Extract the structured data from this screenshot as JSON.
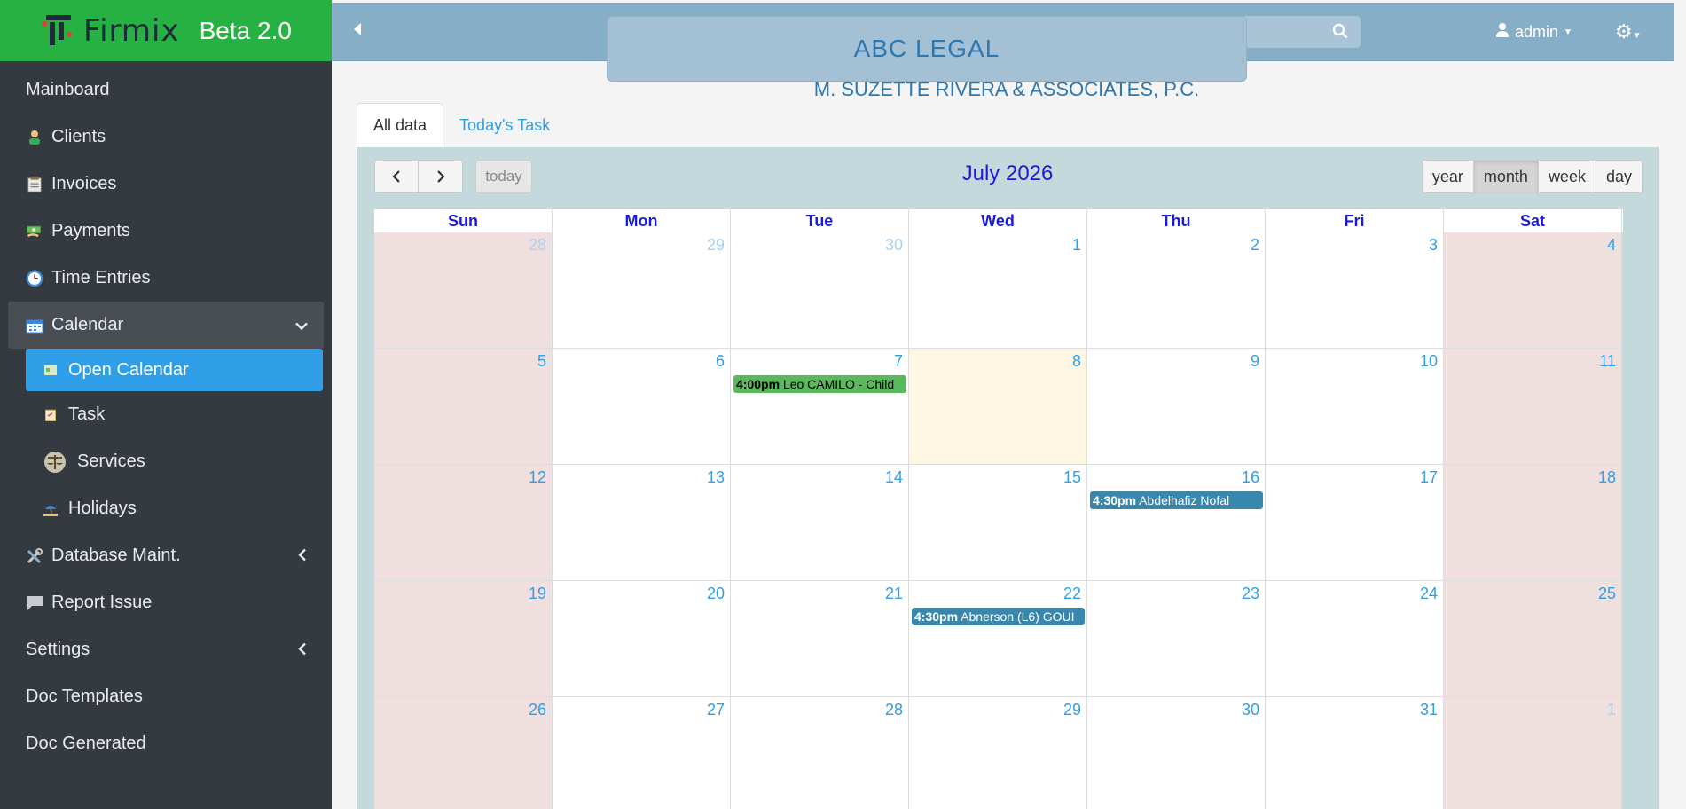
{
  "brand": {
    "name": "Firmix",
    "version": "Beta 2.0"
  },
  "sidebar": {
    "items": [
      {
        "label": "Mainboard",
        "icon": ""
      },
      {
        "label": "Clients",
        "icon": "person-icon"
      },
      {
        "label": "Invoices",
        "icon": "invoice-icon"
      },
      {
        "label": "Payments",
        "icon": "money-icon"
      },
      {
        "label": "Time Entries",
        "icon": "clock-icon"
      },
      {
        "label": "Calendar",
        "icon": "calendar-icon"
      },
      {
        "label": "Database Maint.",
        "icon": "tools-icon"
      },
      {
        "label": "Report Issue",
        "icon": "comment-icon"
      },
      {
        "label": "Settings",
        "icon": ""
      },
      {
        "label": "Doc Templates",
        "icon": ""
      },
      {
        "label": "Doc Generated",
        "icon": ""
      }
    ],
    "calendar_sub": [
      {
        "label": "Open Calendar",
        "icon": "card-icon"
      },
      {
        "label": "Task",
        "icon": "clipboard-icon"
      },
      {
        "label": "Services",
        "icon": "scales-icon"
      },
      {
        "label": "Holidays",
        "icon": "beach-icon"
      }
    ]
  },
  "topbar": {
    "user": "admin"
  },
  "firm": {
    "name": "ABC LEGAL",
    "subtitle": "M. SUZETTE RIVERA & ASSOCIATES, P.C."
  },
  "tabs": [
    {
      "label": "All data"
    },
    {
      "label": "Today's Task"
    }
  ],
  "calendar": {
    "title": "July 2026",
    "today_label": "today",
    "views": [
      "year",
      "month",
      "week",
      "day"
    ],
    "active_view": "month",
    "weekdays": [
      "Sun",
      "Mon",
      "Tue",
      "Wed",
      "Thu",
      "Fri",
      "Sat"
    ],
    "weeks": [
      [
        "28",
        "29",
        "30",
        "1",
        "2",
        "3",
        "4"
      ],
      [
        "5",
        "6",
        "7",
        "8",
        "9",
        "10",
        "11"
      ],
      [
        "12",
        "13",
        "14",
        "15",
        "16",
        "17",
        "18"
      ],
      [
        "19",
        "20",
        "21",
        "22",
        "23",
        "24",
        "25"
      ],
      [
        "26",
        "27",
        "28",
        "29",
        "30",
        "31",
        "1"
      ]
    ],
    "events": [
      {
        "week": 1,
        "day": 2,
        "time": "4:00pm",
        "title": "Leo CAMILO - Child",
        "color": "#5cb85c",
        "text_color": "#000000"
      },
      {
        "week": 2,
        "day": 4,
        "time": "4:30pm",
        "title": "Abdelhafiz Nofal",
        "color": "#3a87ad",
        "text_color": "#ffffff"
      },
      {
        "week": 3,
        "day": 3,
        "time": "4:30pm",
        "title": "Abnerson (L6) GOUI",
        "color": "#3a87ad",
        "text_color": "#ffffff"
      }
    ]
  },
  "colors": {
    "sidebar": "#343a40",
    "brand": "#28b143",
    "accent": "#2f9fe8",
    "topbar": "#86aec6"
  }
}
